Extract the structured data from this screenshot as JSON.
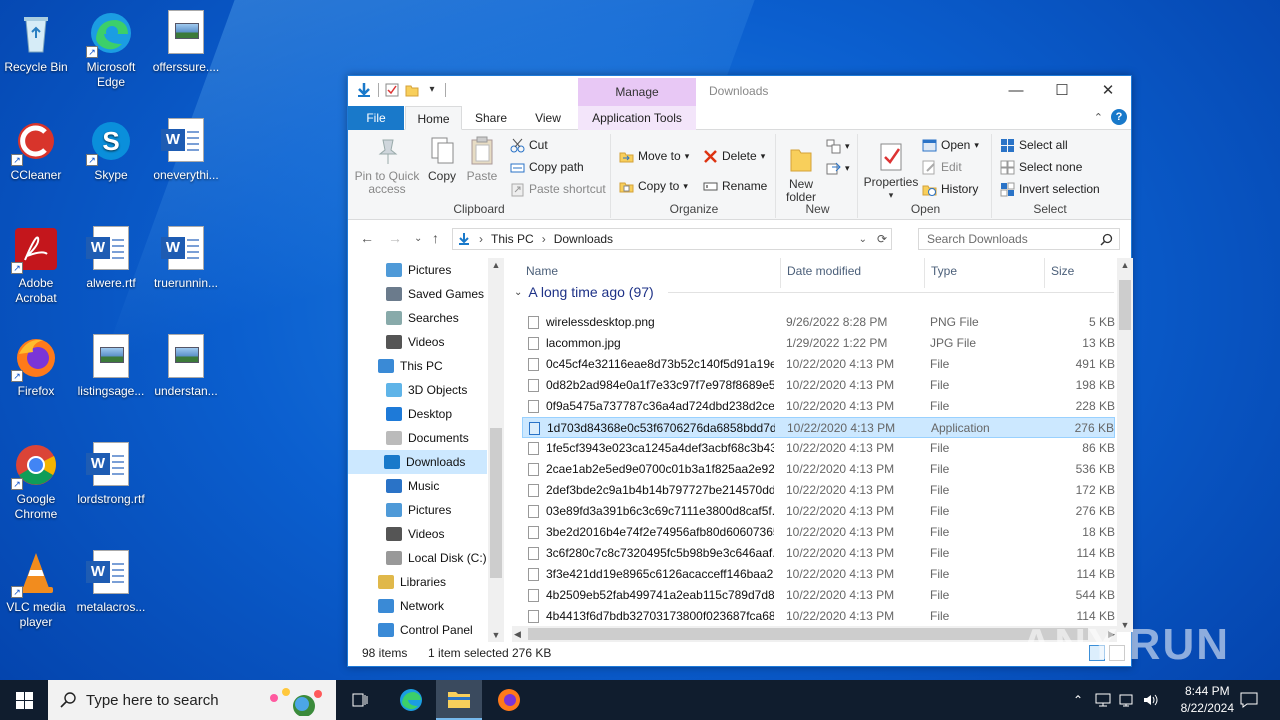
{
  "desktop": {
    "icons": [
      {
        "label": "Recycle Bin"
      },
      {
        "label": "Microsoft Edge"
      },
      {
        "label": "offerssure...."
      },
      {
        "label": "CCleaner"
      },
      {
        "label": "Skype"
      },
      {
        "label": "oneverythi..."
      },
      {
        "label": "Adobe Acrobat"
      },
      {
        "label": "alwere.rtf"
      },
      {
        "label": "truerunnin..."
      },
      {
        "label": "Firefox"
      },
      {
        "label": "listingsage..."
      },
      {
        "label": "understan..."
      },
      {
        "label": "Google Chrome"
      },
      {
        "label": "lordstrong.rtf"
      },
      {
        "label": "VLC media player"
      },
      {
        "label": "metalacros..."
      }
    ],
    "watermark": "ANY.RUN"
  },
  "window": {
    "title": "Downloads",
    "contextual_tab": "Manage",
    "tabs": {
      "file": "File",
      "home": "Home",
      "share": "Share",
      "view": "View",
      "app_tools": "Application Tools"
    },
    "ribbon": {
      "clipboard": {
        "label": "Clipboard",
        "pin": "Pin to Quick access",
        "copy": "Copy",
        "paste": "Paste",
        "cut": "Cut",
        "copy_path": "Copy path",
        "paste_shortcut": "Paste shortcut"
      },
      "organize": {
        "label": "Organize",
        "move_to": "Move to",
        "copy_to": "Copy to",
        "delete": "Delete",
        "rename": "Rename"
      },
      "new": {
        "label": "New",
        "new_folder": "New folder"
      },
      "open": {
        "label": "Open",
        "properties": "Properties",
        "open": "Open",
        "edit": "Edit",
        "history": "History"
      },
      "select": {
        "label": "Select",
        "select_all": "Select all",
        "select_none": "Select none",
        "invert": "Invert selection"
      }
    },
    "address": {
      "this_pc": "This PC",
      "folder": "Downloads",
      "search_placeholder": "Search Downloads"
    },
    "nav": [
      {
        "label": "Pictures",
        "icon": "pictures-icon"
      },
      {
        "label": "Saved Games",
        "icon": "saved-games-icon"
      },
      {
        "label": "Searches",
        "icon": "search-icon"
      },
      {
        "label": "Videos",
        "icon": "videos-icon"
      },
      {
        "label": "This PC",
        "icon": "computer-icon"
      },
      {
        "label": "3D Objects",
        "icon": "cube-icon"
      },
      {
        "label": "Desktop",
        "icon": "desktop-icon"
      },
      {
        "label": "Documents",
        "icon": "documents-icon"
      },
      {
        "label": "Downloads",
        "icon": "downloads-icon"
      },
      {
        "label": "Music",
        "icon": "music-icon"
      },
      {
        "label": "Pictures",
        "icon": "pictures-icon"
      },
      {
        "label": "Videos",
        "icon": "videos-icon"
      },
      {
        "label": "Local Disk (C:)",
        "icon": "drive-icon"
      },
      {
        "label": "Libraries",
        "icon": "libraries-icon"
      },
      {
        "label": "Network",
        "icon": "network-icon"
      },
      {
        "label": "Control Panel",
        "icon": "control-panel-icon"
      }
    ],
    "columns": {
      "name": "Name",
      "date": "Date modified",
      "type": "Type",
      "size": "Size"
    },
    "group": "A long time ago (97)",
    "files": [
      {
        "name": "wirelessdesktop.png",
        "date": "9/26/2022 8:28 PM",
        "type": "PNG File",
        "size": "5 KB"
      },
      {
        "name": "lacommon.jpg",
        "date": "1/29/2022 1:22 PM",
        "type": "JPG File",
        "size": "13 KB"
      },
      {
        "name": "0c45cf4e32116eae8d73b52c140f5d91a19e...",
        "date": "10/22/2020 4:13 PM",
        "type": "File",
        "size": "491 KB"
      },
      {
        "name": "0d82b2ad984e0a1f7e33c97f7e978f8689e5...",
        "date": "10/22/2020 4:13 PM",
        "type": "File",
        "size": "198 KB"
      },
      {
        "name": "0f9a5475a737787c36a4ad724dbd238d2ce...",
        "date": "10/22/2020 4:13 PM",
        "type": "File",
        "size": "228 KB"
      },
      {
        "name": "1d703d84368e0c53f6706276da6858bdd7d...",
        "date": "10/22/2020 4:13 PM",
        "type": "Application",
        "size": "276 KB"
      },
      {
        "name": "1fe5cf3943e023ca1245a4def3acbf68c3b43...",
        "date": "10/22/2020 4:13 PM",
        "type": "File",
        "size": "86 KB"
      },
      {
        "name": "2cae1ab2e5ed9e0700c01b3a1f825aa2e92...",
        "date": "10/22/2020 4:13 PM",
        "type": "File",
        "size": "536 KB"
      },
      {
        "name": "2def3bde2c9a1b4b14b797727be214570dd...",
        "date": "10/22/2020 4:13 PM",
        "type": "File",
        "size": "172 KB"
      },
      {
        "name": "03e89fd3a391b6c3c69c7111e3800d8caf5f...",
        "date": "10/22/2020 4:13 PM",
        "type": "File",
        "size": "276 KB"
      },
      {
        "name": "3be2d2016b4e74f2e74956afb80d60607365...",
        "date": "10/22/2020 4:13 PM",
        "type": "File",
        "size": "18 KB"
      },
      {
        "name": "3c6f280c7c8c7320495fc5b98b9e3c646aaf...",
        "date": "10/22/2020 4:13 PM",
        "type": "File",
        "size": "114 KB"
      },
      {
        "name": "3f3e421dd19e8965c6126acacceff146baa2...",
        "date": "10/22/2020 4:13 PM",
        "type": "File",
        "size": "114 KB"
      },
      {
        "name": "4b2509eb52fab499741a2eab115c789d7d8...",
        "date": "10/22/2020 4:13 PM",
        "type": "File",
        "size": "544 KB"
      },
      {
        "name": "4b4413f6d7bdb32703173800f023687fca68...",
        "date": "10/22/2020 4:13 PM",
        "type": "File",
        "size": "114 KB"
      }
    ],
    "status": {
      "items": "98 items",
      "selected": "1 item selected",
      "size": "276 KB"
    }
  },
  "taskbar": {
    "search_placeholder": "Type here to search",
    "time": "8:44 PM",
    "date": "8/22/2024"
  }
}
